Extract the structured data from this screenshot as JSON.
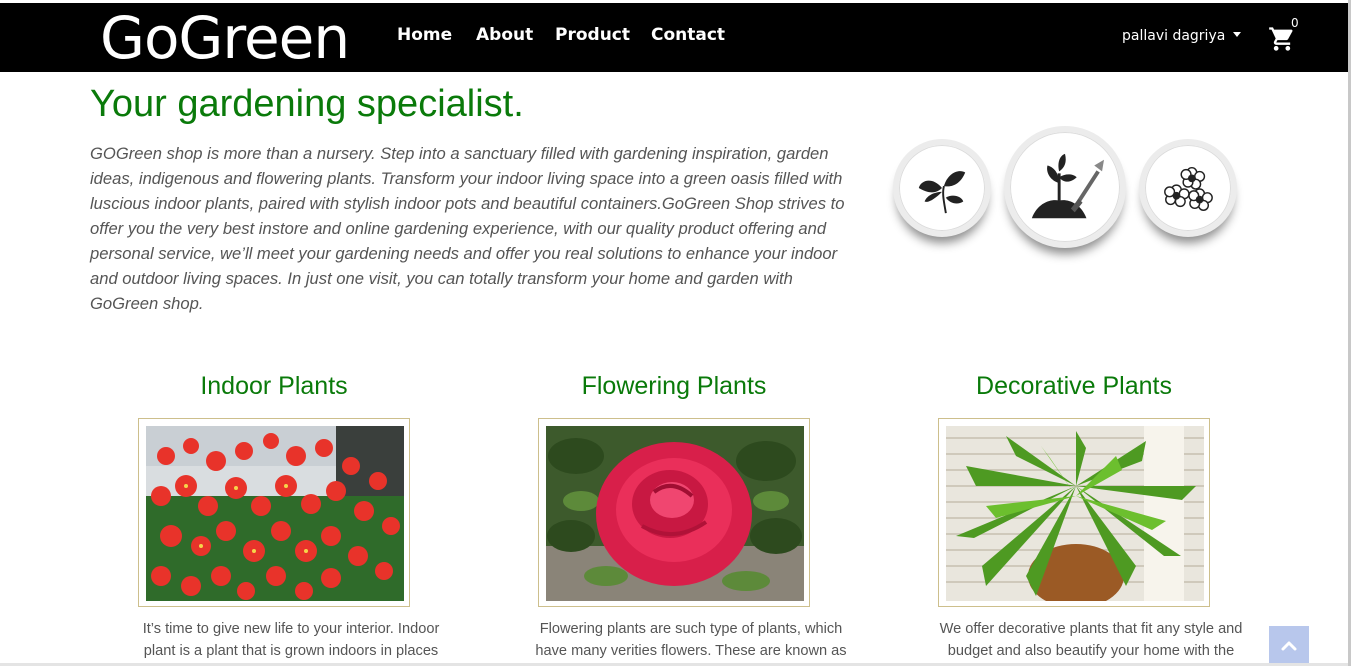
{
  "navbar": {
    "brand": "GoGreen",
    "links": [
      "Home",
      "About",
      "Product",
      "Contact"
    ],
    "user_name": "pallavi dagriya",
    "cart_count": "0"
  },
  "hero": {
    "heading": "Your gardening specialist.",
    "body": "GOGreen shop is more than a nursery. Step into a sanctuary filled with gardening inspiration, garden ideas, indigenous and flowering plants. Transform your indoor living space into a green oasis filled with luscious indoor plants, paired with stylish indoor pots and beautiful containers.GoGreen Shop strives to offer you the very best instore and online gardening experience, with our quality product offering and personal service, we’ll meet your gardening needs and offer you real solutions to enhance your indoor and outdoor living spaces. In just one visit, you can totally transform your home and garden with GoGreen shop.",
    "icons": [
      "leaves-icon",
      "seedling-shovel-icon",
      "flowers-icon"
    ]
  },
  "categories": [
    {
      "title": "Indoor Plants",
      "description": "It’s time to give new life to your interior. Indoor plant is a plant that is grown indoors in places"
    },
    {
      "title": "Flowering Plants",
      "description": "Flowering plants are such type of plants, which have many verities flowers. These are known as"
    },
    {
      "title": "Decorative Plants",
      "description": "We offer decorative plants that fit any style and budget and also beautify your home with the"
    }
  ],
  "colors": {
    "brand_green": "#0a7a0a",
    "navbar": "#000000",
    "scroll_top_button": "#b8c7ec"
  }
}
